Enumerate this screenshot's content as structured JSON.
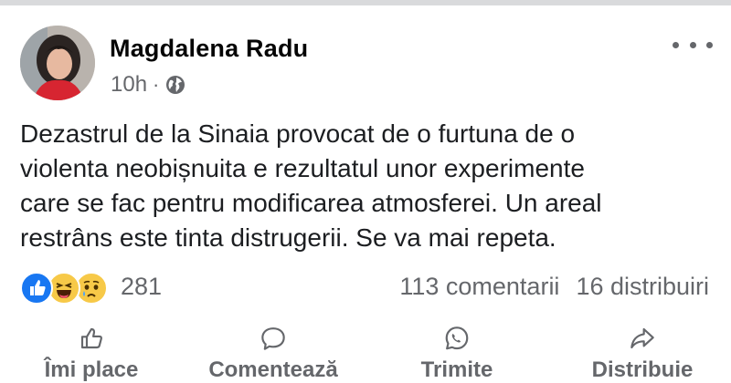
{
  "post": {
    "author": "Magdalena Radu",
    "time": "10h",
    "separator": "·",
    "privacy_icon": "globe-icon",
    "text_lines": [
      "Dezastrul de la Sinaia provocat de o furtuna de o",
      "violenta neobișnuita e rezultatul unor experimente",
      "care se fac pentru modificarea atmosferei. Un areal",
      "restrâns este tinta distrugerii. Se va mai repeta."
    ]
  },
  "reactions": {
    "icons": [
      "like-reaction-icon",
      "haha-reaction-icon",
      "sad-reaction-icon"
    ],
    "count": "281"
  },
  "stats": {
    "comments": "113 comentarii",
    "shares": "16 distribuiri"
  },
  "actions": {
    "like": "Îmi place",
    "comment": "Comentează",
    "send": "Trimite",
    "share": "Distribuie"
  },
  "colors": {
    "secondary_text": "#65676b",
    "like_blue": "#1877f2",
    "emoji_yellow": "#f7c948"
  }
}
